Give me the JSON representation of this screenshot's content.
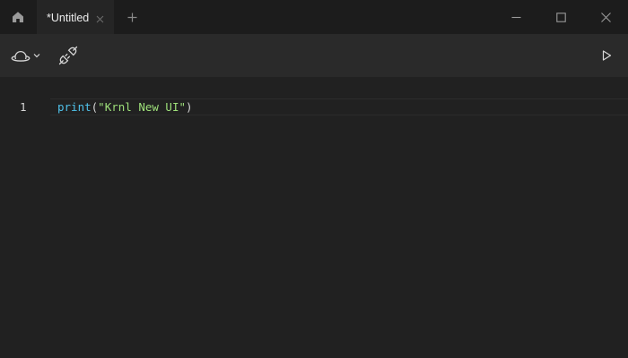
{
  "titlebar": {
    "home_icon": "home-icon",
    "tab": {
      "label": "*Untitled",
      "close_icon": "close-icon"
    },
    "new_tab_icon": "plus-icon",
    "window_controls": {
      "minimize_icon": "minimize-icon",
      "maximize_icon": "maximize-icon",
      "close_icon": "close-icon"
    }
  },
  "toolbar": {
    "execute_icon": "planet-icon",
    "dropdown_icon": "chevron-down-icon",
    "attach_icon": "plug-icon",
    "run_icon": "play-icon"
  },
  "editor": {
    "lines": [
      {
        "number": "1",
        "tokens": {
          "fn": "print",
          "open": "(",
          "string": "\"Krnl New UI\"",
          "close": ")"
        }
      }
    ],
    "colors": {
      "function": "#4fc1e9",
      "string": "#9ee07a",
      "punctuation": "#d4d4d4",
      "background": "#212121"
    }
  }
}
